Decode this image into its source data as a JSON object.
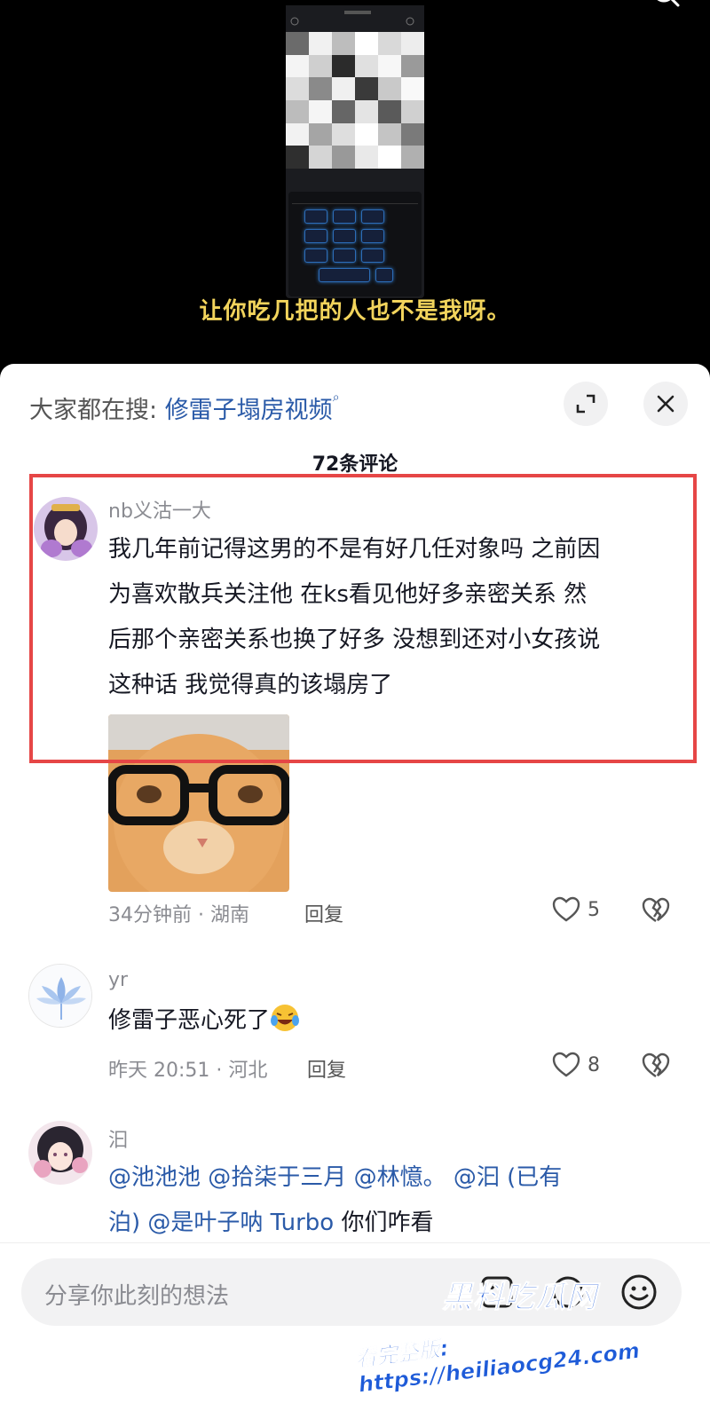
{
  "video": {
    "subtitle": "让你吃几把的人也不是我呀。"
  },
  "panel": {
    "hot_search_prefix": "大家都在搜: ",
    "hot_search_keyword": "修雷子塌房视频",
    "comment_count": "72条评论"
  },
  "comments": [
    {
      "username": "nb义沽一大",
      "lines": [
        "我几年前记得这男的不是有好几任对象吗 之前因",
        "为喜欢散兵关注他 在ks看见他好多亲密关系 然",
        "后那个亲密关系也换了好多 没想到还对小女孩说",
        "这种话 我觉得真的该塌房了"
      ],
      "meta": "34分钟前 · 湖南",
      "reply": "回复",
      "likes": "5"
    },
    {
      "username": "yr",
      "text": "修雷子恶心死了",
      "meta": "昨天 20:51 · 河北",
      "reply": "回复",
      "likes": "8"
    },
    {
      "username": "汩",
      "line1_mentions": [
        "@池池池",
        "@拾柒于三月",
        "@林憶。",
        "@汩 (已有"
      ],
      "line2_mention": "泊) @是叶子呐 Turbo",
      "line2_text": " 你们咋看"
    }
  ],
  "input": {
    "placeholder": "分享你此刻的想法"
  },
  "watermark": {
    "title": "黑料吃瓜网",
    "url": "看完整版: https://heiliaocg24.com"
  },
  "colors": {
    "highlight": "#e64646",
    "link": "#2a5aa8",
    "subtitle": "#f2d45c"
  }
}
